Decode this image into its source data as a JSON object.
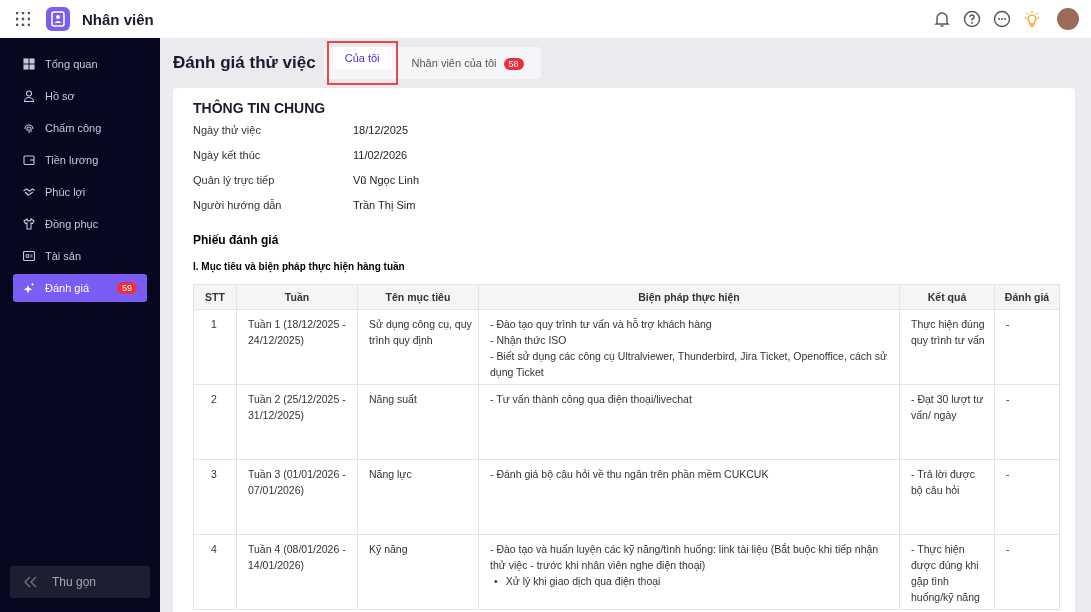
{
  "app": {
    "title": "Nhân viên"
  },
  "sidebar": {
    "items": [
      {
        "label": "Tổng quan",
        "selected": false
      },
      {
        "label": "Hồ sơ",
        "selected": false
      },
      {
        "label": "Chấm công",
        "selected": false
      },
      {
        "label": "Tiền lương",
        "selected": false
      },
      {
        "label": "Phúc lợi",
        "selected": false
      },
      {
        "label": "Đồng phục",
        "selected": false
      },
      {
        "label": "Tài sản",
        "selected": false
      },
      {
        "label": "Đánh giá",
        "selected": true,
        "badge": "59"
      }
    ],
    "collapse": "Thu gọn"
  },
  "page": {
    "title": "Đánh giá thử việc",
    "tabs": [
      {
        "label": "Của tôi",
        "selected": true,
        "highlighted": true
      },
      {
        "label": "Nhân viên của tôi",
        "selected": false,
        "highlighted": false,
        "badge": "58"
      }
    ]
  },
  "general": {
    "title": "THÔNG TIN CHUNG",
    "fields": [
      {
        "label": "Ngày thử việc",
        "value": "18/12/2025"
      },
      {
        "label": "Ngày kết thúc",
        "value": "11/02/2026"
      },
      {
        "label": "Quản lý trực tiếp",
        "value": "Vũ Ngọc Linh"
      },
      {
        "label": "Người hướng dẫn",
        "value": "Trần Thị Sim"
      }
    ]
  },
  "form": {
    "title": "Phiếu đánh giá",
    "section": "I. Mục tiêu và biện pháp thực hiện hàng tuần",
    "table": {
      "columns": [
        "STT",
        "Tuần",
        "Tên mục tiêu",
        "Biện pháp thực hiện",
        "Kết quả",
        "Đánh giá"
      ],
      "rows": [
        {
          "stt": "1",
          "week": "Tuần 1 (18/12/2025 - 24/12/2025)",
          "goal": "Sử dụng công cụ, quy trình quy định",
          "measures": [
            "- Đào tạo quy trình tư vấn và hỗ trợ khách hàng",
            "- Nhận thức ISO",
            "- Biết sử dụng các công cụ Ultralviewer, Thunderbird, Jira Ticket, Openoffice, cách sử dụng Ticket"
          ],
          "bullets": [],
          "result": "Thực hiện đúng quy trình tư vấn",
          "rating": "-"
        },
        {
          "stt": "2",
          "week": "Tuần 2 (25/12/2025 - 31/12/2025)",
          "goal": "Năng suất",
          "measures": [
            "- Tư vấn thành công qua điện thoại/livechat"
          ],
          "bullets": [],
          "result": "- Đạt 30 lượt tư vấn/ ngày",
          "rating": "-"
        },
        {
          "stt": "3",
          "week": "Tuần 3 (01/01/2026 - 07/01/2026)",
          "goal": "Năng lực",
          "measures": [
            "- Đánh giá bộ câu hỏi về thu ngân trên phần mềm CUKCUK"
          ],
          "bullets": [],
          "result": "- Trả lời được bộ câu hỏi",
          "rating": "-"
        },
        {
          "stt": "4",
          "week": "Tuần 4 (08/01/2026 - 14/01/2026)",
          "goal": "Kỹ năng",
          "measures": [
            "- Đào tạo và huấn luyện các kỹ năng/tình huống: link tài liệu (Bắt buộc khi tiếp nhận thử việc - trước khi nhân viên nghe điện thoại)"
          ],
          "bullets": [
            {
              "marker": "•",
              "text": "Xử lý khi giao dịch qua điện thoại"
            }
          ],
          "result": "- Thực hiện được đúng khi gặp tình huống/kỹ năng",
          "rating": "-"
        }
      ]
    }
  }
}
